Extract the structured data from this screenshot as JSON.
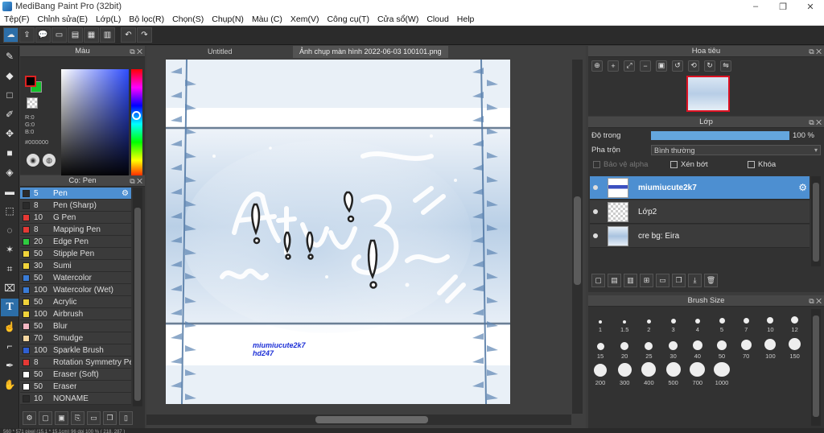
{
  "window": {
    "title": "MediBang Paint Pro (32bit)",
    "controls": [
      "–",
      "❐",
      "✕"
    ]
  },
  "menu": [
    "Tệp(F)",
    "Chỉnh sửa(E)",
    "Lớp(L)",
    "Bộ lọc(R)",
    "Chọn(S)",
    "Chụp(N)",
    "Màu (C)",
    "Xem(V)",
    "Công cụ(T)",
    "Cửa sổ(W)",
    "Cloud",
    "Help"
  ],
  "color_panel": {
    "title": "Màu",
    "rgb": [
      "R:0",
      "G:0",
      "B:0"
    ],
    "hex": "#000000",
    "fg_color": "#000000",
    "bg_color": "#12c22b"
  },
  "brush_panel": {
    "title": "Cọ: Pen",
    "items": [
      {
        "size": "5",
        "name": "Pen",
        "color": "#2b2b2b",
        "selected": true
      },
      {
        "size": "8",
        "name": "Pen (Sharp)",
        "color": "#2b2b2b"
      },
      {
        "size": "10",
        "name": "G Pen",
        "color": "#e53935"
      },
      {
        "size": "8",
        "name": "Mapping Pen",
        "color": "#e53935"
      },
      {
        "size": "20",
        "name": "Edge Pen",
        "color": "#2ecc40"
      },
      {
        "size": "50",
        "name": "Stipple Pen",
        "color": "#f0d33a"
      },
      {
        "size": "30",
        "name": "Sumi",
        "color": "#f0d33a"
      },
      {
        "size": "50",
        "name": "Watercolor",
        "color": "#3a7bd5"
      },
      {
        "size": "100",
        "name": "Watercolor (Wet)",
        "color": "#3a7bd5"
      },
      {
        "size": "50",
        "name": "Acrylic",
        "color": "#f0d33a"
      },
      {
        "size": "100",
        "name": "Airbrush",
        "color": "#f0d33a"
      },
      {
        "size": "50",
        "name": "Blur",
        "color": "#f4b6c2"
      },
      {
        "size": "70",
        "name": "Smudge",
        "color": "#f4d6a0"
      },
      {
        "size": "100",
        "name": "Sparkle Brush",
        "color": "#2f5fd0"
      },
      {
        "size": "8",
        "name": "Rotation Symmetry Pen",
        "color": "#e53935"
      },
      {
        "size": "50",
        "name": "Eraser (Soft)",
        "color": "#ffffff"
      },
      {
        "size": "50",
        "name": "Eraser",
        "color": "#ffffff"
      },
      {
        "size": "10",
        "name": "NONAME",
        "color": "#2b2b2b"
      }
    ]
  },
  "document": {
    "tabs": [
      "Untitled",
      "Ảnh chụp màn hình 2022-06-03 100101.png"
    ],
    "signature": [
      "miumiucute2k7",
      "hd247"
    ]
  },
  "navigator_panel": {
    "title": "Hoa tiêu"
  },
  "layer_panel": {
    "title": "Lớp",
    "opacity_label": "Độ trong",
    "opacity_value": "100 %",
    "opacity_fraction": 1.0,
    "blend_label": "Pha trộn",
    "blend_value": "Bình thường",
    "alpha_protect": "Bảo vệ alpha",
    "clipping": "Xén bớt",
    "lock": "Khóa",
    "layers": [
      {
        "name": "miumiucute2k7",
        "selected": true
      },
      {
        "name": "Lớp2",
        "selected": false
      },
      {
        "name": "cre bg: Eira",
        "selected": false
      }
    ]
  },
  "brush_size_panel": {
    "title": "Brush Size",
    "sizes": [
      "1",
      "1.5",
      "2",
      "3",
      "4",
      "5",
      "7",
      "10",
      "12",
      "15",
      "20",
      "25",
      "30",
      "40",
      "50",
      "70",
      "100",
      "150",
      "200",
      "300",
      "400",
      "500",
      "700",
      "1000"
    ]
  },
  "status": "560 * 571 pixel  (15.1 * 15.1cm)  96 dpi  100 %  ( 218, 287 )",
  "accent_color": "#4d8fd1"
}
